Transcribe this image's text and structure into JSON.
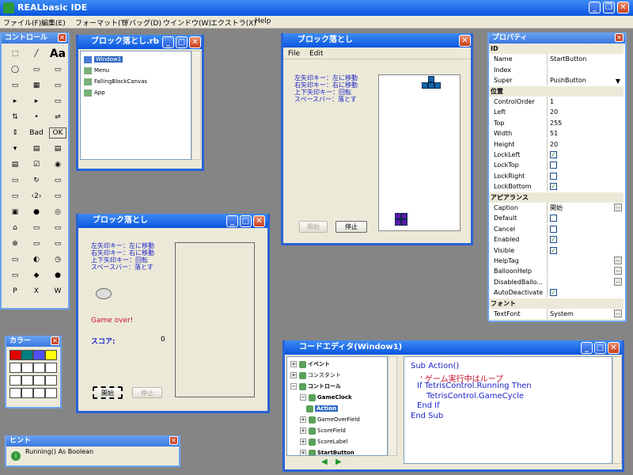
{
  "app": {
    "title": "REALbasic IDE"
  },
  "menubar": [
    "ファイル(F)",
    "編集(E)",
    "フォーマット(T)",
    "デバッグ(D)",
    "ウインドウ(W)",
    "エクストラ(X)",
    "Help"
  ],
  "controls": {
    "title": "コントロール",
    "text_tool": "Aa",
    "bad": "Bad",
    "ok": "OK"
  },
  "project": {
    "title": "ブロック落とし.rb",
    "items": [
      "Window1",
      "Menu",
      "FallingBlockCanvas",
      "App"
    ]
  },
  "runwin": {
    "title": "ブロック落とし",
    "menu": [
      "File",
      "Edit"
    ],
    "instructions": [
      "左矢印キー：左に移動",
      "右矢印キー：右に移動",
      "上下矢印キー：回転",
      "スペースバー：落とす"
    ],
    "start": "開始",
    "stop": "停止"
  },
  "designwin": {
    "title": "ブロック落とし",
    "instructions": [
      "左矢印キー：左に移動",
      "右矢印キー：右に移動",
      "上下矢印キー：回転",
      "スペースバー：落とす"
    ],
    "gameover": "Game over!",
    "score_label": "スコア:",
    "score": "0",
    "start": "開始",
    "stop": "停止"
  },
  "props": {
    "title": "プロパティ",
    "sections": {
      "id": "ID",
      "pos": "位置",
      "appearance": "アピアランス",
      "font": "フォント"
    },
    "rows": [
      {
        "k": "Name",
        "v": "StartButton"
      },
      {
        "k": "Index",
        "v": ""
      },
      {
        "k": "Super",
        "v": "PushButton"
      },
      {
        "k": "ControlOrder",
        "v": "1"
      },
      {
        "k": "Left",
        "v": "20"
      },
      {
        "k": "Top",
        "v": "255"
      },
      {
        "k": "Width",
        "v": "51"
      },
      {
        "k": "Height",
        "v": "20"
      },
      {
        "k": "LockLeft",
        "v": "✓"
      },
      {
        "k": "LockTop",
        "v": ""
      },
      {
        "k": "LockRight",
        "v": ""
      },
      {
        "k": "LockBottom",
        "v": "✓"
      },
      {
        "k": "Caption",
        "v": "開始"
      },
      {
        "k": "Default",
        "v": ""
      },
      {
        "k": "Cancel",
        "v": ""
      },
      {
        "k": "Enabled",
        "v": "✓"
      },
      {
        "k": "Visible",
        "v": "✓"
      },
      {
        "k": "HelpTag",
        "v": ""
      },
      {
        "k": "BalloonHelp",
        "v": ""
      },
      {
        "k": "DisabledBallo...",
        "v": ""
      },
      {
        "k": "AutoDeactivate",
        "v": "✓"
      },
      {
        "k": "TextFont",
        "v": "System"
      }
    ]
  },
  "colors": {
    "title": "カラー",
    "palette": [
      "#e00000",
      "#008080",
      "#5050ff",
      "#ffff00"
    ]
  },
  "hint": {
    "title": "ヒント",
    "text": "Running() As Boolean"
  },
  "editor": {
    "title": "コードエディタ(Window1)",
    "tree": [
      {
        "label": "イベント",
        "bold": true
      },
      {
        "label": "コンスタント",
        "bold": false
      },
      {
        "label": "コントロール",
        "bold": true
      },
      {
        "label": "GameClock",
        "bold": true
      },
      {
        "label": "Action",
        "bold": true
      },
      {
        "label": "GameOverField",
        "bold": false
      },
      {
        "label": "ScoreField",
        "bold": false
      },
      {
        "label": "ScoreLabel",
        "bold": false
      },
      {
        "label": "StartButton",
        "bold": true
      }
    ],
    "code": [
      "Sub Action()",
      "  ' ゲーム実行中はループ",
      "  If TetrisControl.Running Then",
      "    TetrisControl.GameCycle",
      "  End If",
      "End Sub"
    ]
  },
  "theme": {
    "title_blue": "#0a55df",
    "code_blue": "#1d24c9",
    "code_red": "#c8102e",
    "piece_blue": "#1466a8",
    "piece_purple": "#5a1aa8"
  }
}
